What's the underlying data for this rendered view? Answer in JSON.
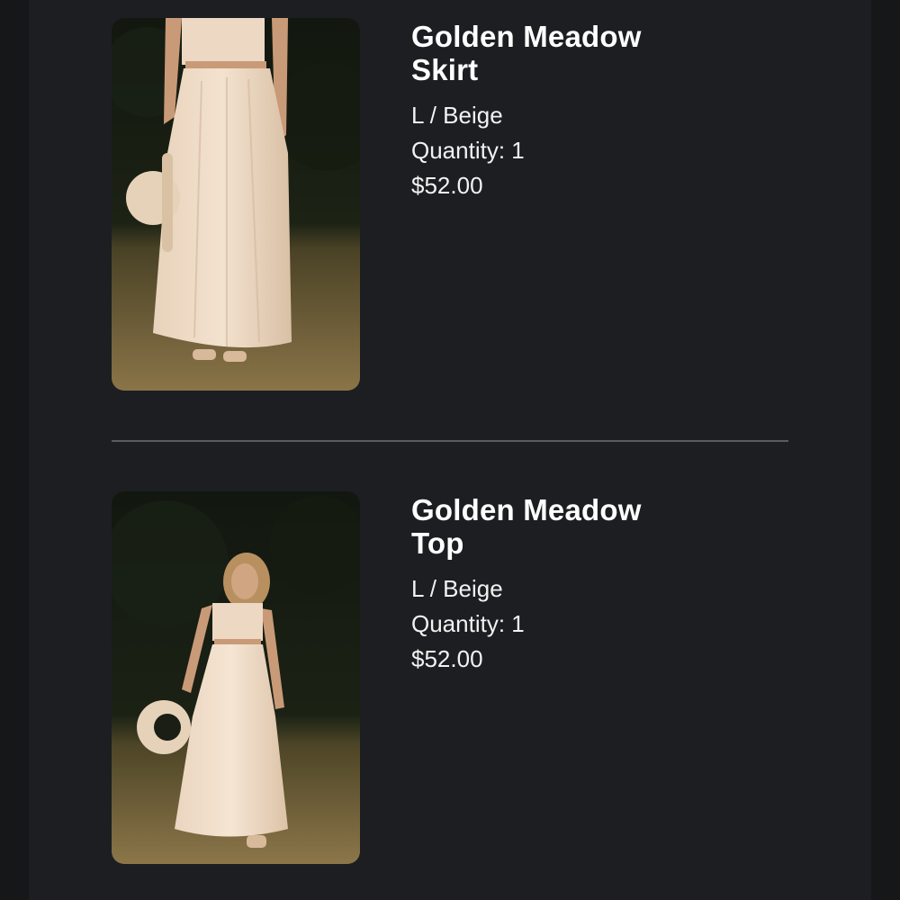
{
  "order_items": [
    {
      "title": "Golden Meadow\nSkirt",
      "variant": "L / Beige",
      "quantity": "Quantity: 1",
      "price": "$52.00",
      "image": "product-photo-skirt"
    },
    {
      "title": "Golden Meadow\nTop",
      "variant": "L / Beige",
      "quantity": "Quantity: 1",
      "price": "$52.00",
      "image": "product-photo-top"
    }
  ],
  "colors": {
    "background": "#151719",
    "panel": "#1c1e21",
    "text": "#ffffff",
    "divider": "#5a5c60"
  }
}
